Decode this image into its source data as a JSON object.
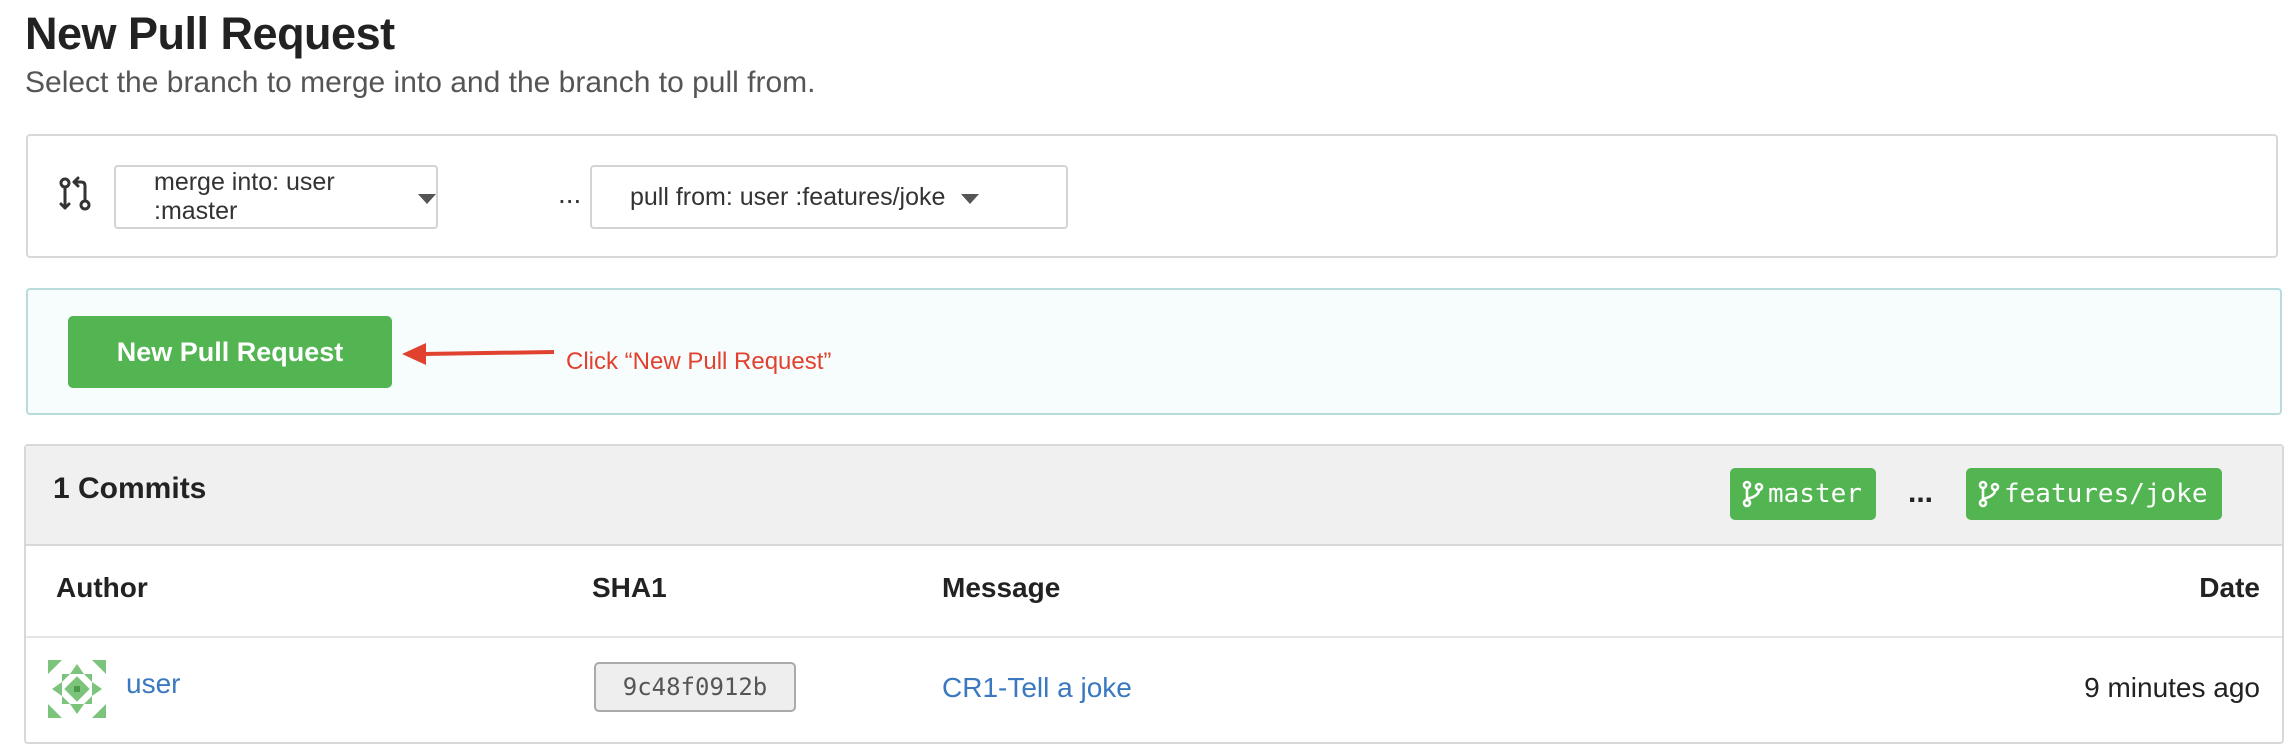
{
  "page": {
    "title": "New Pull Request",
    "subtitle": "Select the branch to merge into and the branch to pull from."
  },
  "branch_select": {
    "merge_into_label": "merge into: user :master",
    "separator": "...",
    "pull_from_label": "pull from: user :features/joke"
  },
  "action": {
    "button_label": "New Pull Request",
    "annotation": "Click “New Pull Request”"
  },
  "commits": {
    "title": "1 Commits",
    "base_branch": "master",
    "separator": "...",
    "head_branch": "features/joke",
    "columns": [
      "Author",
      "SHA1",
      "Message",
      "Date"
    ],
    "rows": [
      {
        "author": "user",
        "sha": "9c48f0912b",
        "message": "CR1-Tell a joke",
        "date": "9 minutes ago"
      }
    ]
  },
  "colors": {
    "primary_green": "#53b551",
    "link_blue": "#3a78c0",
    "annotation_red": "#e0422f"
  },
  "icons": {
    "compare": "compare-branches-icon",
    "branch": "git-branch-icon",
    "caret": "caret-down-icon"
  }
}
